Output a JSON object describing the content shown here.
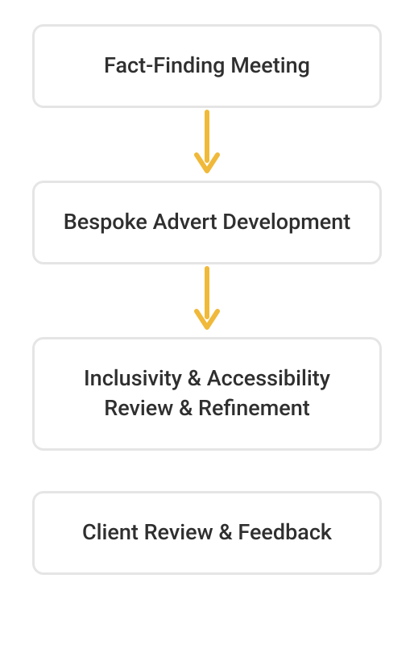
{
  "colors": {
    "arrow": "#f0b93a",
    "border": "#e5e5e5",
    "text": "#2f2f2f"
  },
  "steps": [
    {
      "label": "Fact-Finding Meeting"
    },
    {
      "label": "Bespoke Advert Development"
    },
    {
      "label": "Inclusivity & Accessibility Review & Refinement"
    },
    {
      "label": "Client Review & Feedback"
    }
  ],
  "chart_data": {
    "type": "flow",
    "nodes": [
      "Fact-Finding Meeting",
      "Bespoke Advert Development",
      "Inclusivity & Accessibility Review & Refinement",
      "Client Review & Feedback"
    ],
    "edges": [
      {
        "from": 0,
        "to": 1,
        "arrow": true
      },
      {
        "from": 1,
        "to": 2,
        "arrow": true
      }
    ]
  }
}
